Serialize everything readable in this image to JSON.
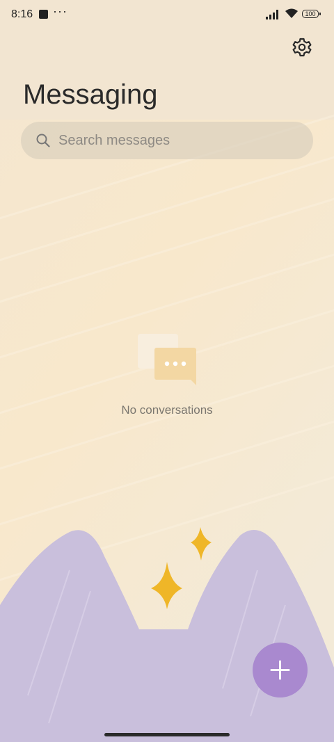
{
  "status_bar": {
    "time": "8:16",
    "dots": "···",
    "battery_level": "100"
  },
  "header": {
    "title": "Messaging"
  },
  "search": {
    "placeholder": "Search messages",
    "value": ""
  },
  "empty_state": {
    "text": "No conversations"
  },
  "icons": {
    "settings": "gear-icon",
    "search": "search-icon",
    "compose": "plus-icon",
    "empty": "chat-bubbles-icon"
  },
  "colors": {
    "background": "#f6ead6",
    "accent_fab": "#a989cf",
    "mountains": "#c9bfdc",
    "sparkles": "#efb628"
  }
}
